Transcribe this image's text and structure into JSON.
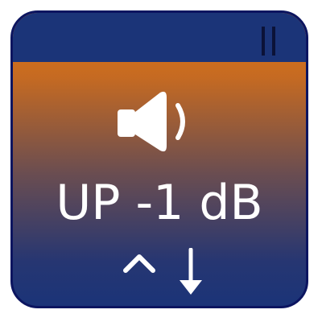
{
  "tile": {
    "label": "UP -1 dB",
    "icons": {
      "status": "pause-icon",
      "main": "speaker-icon",
      "left_hint": "caret-up-icon",
      "right_hint": "arrow-down-icon"
    }
  },
  "colors": {
    "border": "#0c1560",
    "topbar": "#1b3478",
    "gradient_top": "#e57812",
    "gradient_bottom": "#1b3478",
    "foreground": "#ffffff"
  }
}
